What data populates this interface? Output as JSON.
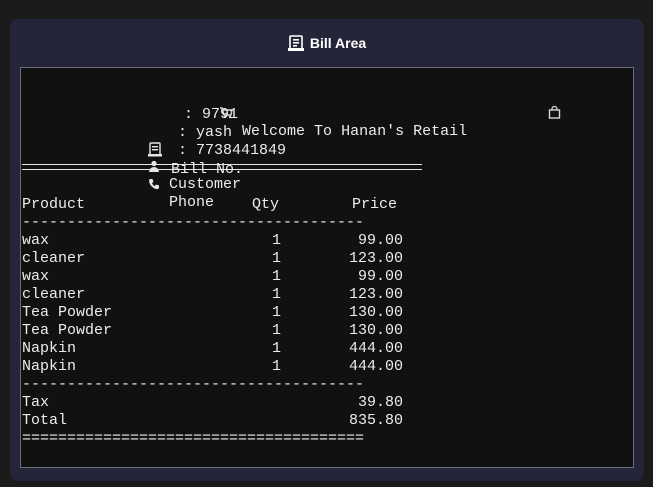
{
  "panel": {
    "title": "Bill Area",
    "icon": "receipt-icon"
  },
  "bill": {
    "welcome": "Welcome To Hanan's Retail",
    "welcome_left_icon": "cart-icon",
    "welcome_right_icon": "shopping-bag-icon",
    "bill_no_label": "Bill No.",
    "bill_no_value": "9791",
    "customer_label": "Customer",
    "customer_value": "yash",
    "phone_label": "Phone",
    "phone_value": "7738441849",
    "header": {
      "product": "Product",
      "qty": "Qty",
      "price": "Price"
    },
    "dash_line": "--------------------------------------",
    "eq_line": "======================================",
    "items": [
      {
        "product": "wax",
        "qty": "1",
        "price": "99.00"
      },
      {
        "product": "cleaner",
        "qty": "1",
        "price": "123.00"
      },
      {
        "product": "wax",
        "qty": "1",
        "price": "99.00"
      },
      {
        "product": "cleaner",
        "qty": "1",
        "price": "123.00"
      },
      {
        "product": "Tea Powder",
        "qty": "1",
        "price": "130.00"
      },
      {
        "product": "Tea Powder",
        "qty": "1",
        "price": "130.00"
      },
      {
        "product": "Napkin",
        "qty": "1",
        "price": "444.00"
      },
      {
        "product": "Napkin",
        "qty": "1",
        "price": "444.00"
      }
    ],
    "tax_label": "Tax",
    "tax_value": "39.80",
    "total_label": "Total",
    "total_value": "835.80"
  },
  "colors": {
    "background": "#1b1b1c",
    "panel": "#25253a",
    "bill_bg": "#111111",
    "text": "#ececec"
  }
}
